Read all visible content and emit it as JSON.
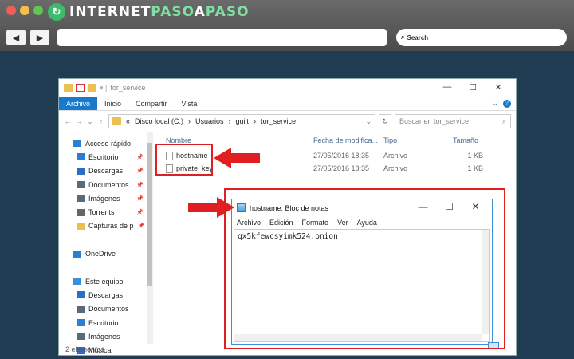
{
  "brand": {
    "text_a": "INTERNET",
    "text_b": "PASO",
    "text_c": "A",
    "text_d": "PASO"
  },
  "browser": {
    "search_label": "Search"
  },
  "explorer": {
    "title": "tor_service",
    "ribbon_tabs": [
      "Archivo",
      "Inicio",
      "Compartir",
      "Vista"
    ],
    "address": {
      "prefix": "«",
      "parts": [
        "Disco local (C:)",
        "Usuarios",
        "guilt",
        "tor_service"
      ],
      "separator": "›"
    },
    "search_placeholder": "Buscar en tor_service",
    "nav": [
      {
        "label": "Acceso rápido",
        "icon": "star-icon",
        "color": "#2b7fd0",
        "sub": false,
        "pin": false
      },
      {
        "label": "Escritorio",
        "icon": "desktop-icon",
        "color": "#2b7fd0",
        "sub": true,
        "pin": true
      },
      {
        "label": "Descargas",
        "icon": "download-icon",
        "color": "#2b6fc0",
        "sub": true,
        "pin": true
      },
      {
        "label": "Documentos",
        "icon": "documents-icon",
        "color": "#5a6a7a",
        "sub": true,
        "pin": true
      },
      {
        "label": "Imágenes",
        "icon": "images-icon",
        "color": "#5a6a7a",
        "sub": true,
        "pin": true
      },
      {
        "label": "Torrents",
        "icon": "torrents-icon",
        "color": "#666666",
        "sub": true,
        "pin": true
      },
      {
        "label": "Capturas de p",
        "icon": "folder-icon",
        "color": "#e8c150",
        "sub": true,
        "pin": true
      },
      {
        "label": "",
        "icon": "",
        "color": "",
        "sub": false,
        "pin": false
      },
      {
        "label": "OneDrive",
        "icon": "onedrive-icon",
        "color": "#2b7fd0",
        "sub": false,
        "pin": false
      },
      {
        "label": "",
        "icon": "",
        "color": "",
        "sub": false,
        "pin": false
      },
      {
        "label": "Este equipo",
        "icon": "computer-icon",
        "color": "#3b8fd8",
        "sub": false,
        "pin": false
      },
      {
        "label": "Descargas",
        "icon": "download-icon",
        "color": "#2b6fc0",
        "sub": true,
        "pin": false
      },
      {
        "label": "Documentos",
        "icon": "documents-icon",
        "color": "#5a6a7a",
        "sub": true,
        "pin": false
      },
      {
        "label": "Escritorio",
        "icon": "desktop-icon",
        "color": "#2b7fd0",
        "sub": true,
        "pin": false
      },
      {
        "label": "Imágenes",
        "icon": "images-icon",
        "color": "#5a6a7a",
        "sub": true,
        "pin": false
      },
      {
        "label": "Música",
        "icon": "music-icon",
        "color": "#2b6fc0",
        "sub": true,
        "pin": false
      }
    ],
    "columns": [
      "Nombre",
      "Fecha de modifica...",
      "Tipo",
      "Tamaño"
    ],
    "files": [
      {
        "name": "hostname",
        "date": "27/05/2016 18:35",
        "type": "Archivo",
        "size": "1 KB"
      },
      {
        "name": "private_key",
        "date": "27/05/2016 18:35",
        "type": "Archivo",
        "size": "1 KB"
      }
    ],
    "status": "2 elementos"
  },
  "notepad": {
    "title": "hostname: Bloc de notas",
    "menu": [
      "Archivo",
      "Edición",
      "Formato",
      "Ver",
      "Ayuda"
    ],
    "content": "qx5kfewcsyimk524.onion"
  },
  "colors": {
    "highlight": "#e02020",
    "accent": "#1979ca"
  }
}
